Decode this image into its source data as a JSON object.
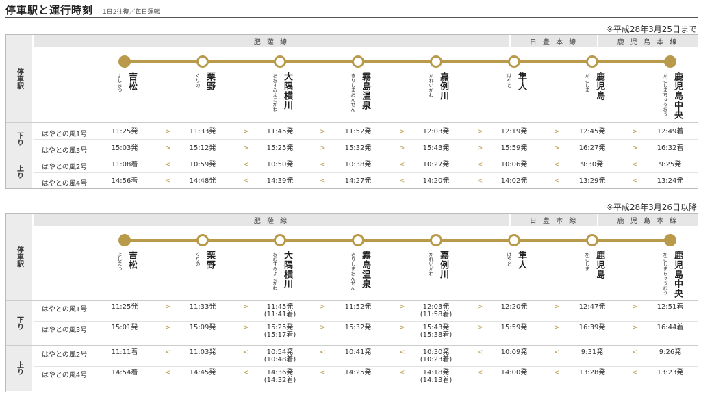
{
  "header": {
    "title": "停車駅と運行時刻",
    "subtitle": "1日2往復／毎日運転"
  },
  "side_labels": {
    "stations": "停車駅",
    "down": "下り",
    "up": "上り"
  },
  "lines": {
    "hisatsu": "肥 薩 線",
    "nippo": "日 豊 本 線",
    "kagoshima": "鹿 児 島 本 線"
  },
  "stations": [
    {
      "kanji": "吉松",
      "kana": "よしまつ"
    },
    {
      "kanji": "栗野",
      "kana": "くりの"
    },
    {
      "kanji": "大隅横川",
      "kana": "おおすみよこがわ"
    },
    {
      "kanji": "霧島温泉",
      "kana": "きりしまおんせん"
    },
    {
      "kanji": "嘉例川",
      "kana": "かれいがわ"
    },
    {
      "kanji": "隼人",
      "kana": "はやと"
    },
    {
      "kanji": "鹿児島",
      "kana": "かごしま"
    },
    {
      "kanji": "鹿児島中央",
      "kana": "かごしまちゅうおう"
    }
  ],
  "timetables": [
    {
      "note": "※平成28年3月25日まで",
      "down": [
        {
          "name": "はやとの風1号",
          "times": [
            "11:25発",
            "11:33発",
            "11:45発",
            "11:52発",
            "12:03発",
            "12:19発",
            "12:45発",
            "12:49着"
          ],
          "subs": [
            "",
            "",
            "",
            "",
            "",
            "",
            "",
            ""
          ]
        },
        {
          "name": "はやとの風3号",
          "times": [
            "15:03発",
            "15:12発",
            "15:25発",
            "15:32発",
            "15:43発",
            "15:59発",
            "16:27発",
            "16:32着"
          ],
          "subs": [
            "",
            "",
            "",
            "",
            "",
            "",
            "",
            ""
          ]
        }
      ],
      "up": [
        {
          "name": "はやとの風2号",
          "times": [
            "11:08着",
            "10:59発",
            "10:50発",
            "10:38発",
            "10:27発",
            "10:06発",
            "9:30発",
            "9:25発"
          ],
          "subs": [
            "",
            "",
            "",
            "",
            "",
            "",
            "",
            ""
          ]
        },
        {
          "name": "はやとの風4号",
          "times": [
            "14:56着",
            "14:48発",
            "14:39発",
            "14:27発",
            "14:20発",
            "14:02発",
            "13:29発",
            "13:24発"
          ],
          "subs": [
            "",
            "",
            "",
            "",
            "",
            "",
            "",
            ""
          ]
        }
      ]
    },
    {
      "note": "※平成28年3月26日以降",
      "down": [
        {
          "name": "はやとの風1号",
          "times": [
            "11:25発",
            "11:33発",
            "11:45発",
            "11:52発",
            "12:03発",
            "12:20発",
            "12:47発",
            "12:51着"
          ],
          "subs": [
            "",
            "",
            "(11:41着)",
            "",
            "(11:58着)",
            "",
            "",
            ""
          ]
        },
        {
          "name": "はやとの風3号",
          "times": [
            "15:01発",
            "15:09発",
            "15:25発",
            "15:32発",
            "15:43発",
            "15:59発",
            "16:39発",
            "16:44着"
          ],
          "subs": [
            "",
            "",
            "(15:17着)",
            "",
            "(15:38着)",
            "",
            "",
            ""
          ]
        }
      ],
      "up": [
        {
          "name": "はやとの風2号",
          "times": [
            "11:11着",
            "11:03発",
            "10:54発",
            "10:41発",
            "10:30発",
            "10:09発",
            "9:31発",
            "9:26発"
          ],
          "subs": [
            "",
            "",
            "(10:48着)",
            "",
            "(10:23着)",
            "",
            "",
            ""
          ]
        },
        {
          "name": "はやとの風4号",
          "times": [
            "14:54着",
            "14:45発",
            "14:36発",
            "14:25発",
            "14:18発",
            "14:00発",
            "13:28発",
            "13:23発"
          ],
          "subs": [
            "",
            "",
            "(14:32着)",
            "",
            "(14:13着)",
            "",
            "",
            ""
          ]
        }
      ]
    }
  ],
  "arrows": {
    "down": ">",
    "up": "<"
  },
  "colors": {
    "accent": "#b89a4a",
    "bar": "#e6e6e6"
  }
}
